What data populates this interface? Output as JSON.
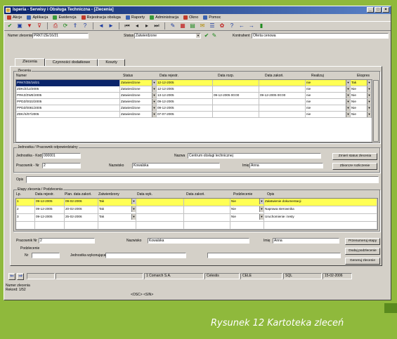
{
  "window": {
    "title": "Isperia - Serwisy i Obsługa Techniczna - [Zlecenia]"
  },
  "menu": [
    "Akcje",
    "Aplikacja",
    "Ewidencja",
    "Rejestracja obsługa",
    "Raporty",
    "Administracja",
    "Okno",
    "Pomoc"
  ],
  "toolbar_icons": [
    "check-icon",
    "save-icon",
    "filter-icon",
    "filter-clear-icon",
    "print-icon",
    "refresh-icon",
    "up-icon",
    "help-icon",
    "back-icon",
    "forward-icon",
    "first-icon",
    "prev-icon",
    "next-icon",
    "last-icon",
    "tools-icon",
    "calendar-icon",
    "calc-icon",
    "notes-icon",
    "mail-icon",
    "settings-icon",
    "question-icon",
    "arrow-left-icon",
    "arrow-right-icon",
    "exit-icon"
  ],
  "filters": {
    "order_no_label": "Numer zlecenia",
    "order_no_value": "PRKT/ZE/16/21",
    "status_label": "Status",
    "status_value": "Zatwierdzone",
    "client_label": "Kontrahent",
    "client_value": "Oferta cenowa"
  },
  "tabs": [
    "Zlecenia",
    "Czynności dodatkowe",
    "Koszty"
  ],
  "orders": {
    "group_label": "Zlecenia",
    "headers": [
      "Numer",
      "Status",
      "Data rejestr.",
      "Data rozp.",
      "Data zakoń.",
      "Realizuj",
      "Ekspres"
    ],
    "rows": [
      [
        "PRKT/ZE/16/21",
        "Zatwierdzone",
        "12-12-2005",
        "",
        "",
        "nie",
        "Tak"
      ],
      [
        "ZDK/Z/12/2005",
        "Zatwierdzone",
        "12-12-2005",
        "",
        "",
        "nie",
        "Nie"
      ],
      [
        "PRKZ/ZWE/2005",
        "Zatwierdzone",
        "13-12-2005",
        "09-12-2005 00:00",
        "09-12-2005 00:00",
        "nie",
        "Nie"
      ],
      [
        "PPDZ/0022/2005",
        "Zatwierdzone",
        "09-12-2005",
        "",
        "",
        "nie",
        "Nie"
      ],
      [
        "PPDZ/0081/2005",
        "Zatwierdzone",
        "09-12-2005",
        "",
        "",
        "nie",
        "Nie"
      ],
      [
        "ZDK/S/07/2005",
        "Zatwierdzone",
        "07-07-2005",
        "",
        "",
        "nie",
        "Nie"
      ]
    ]
  },
  "unit": {
    "group_label": "Jednostka / Pracownik odpowiedzialny",
    "unit_code_label": "Jednostka - Kod",
    "unit_code_value": "000001",
    "unit_name_label": "Nazwa",
    "unit_name_value": "Centrum obsługi technicznej",
    "employee_label": "Pracownik - Nr",
    "employee_no": "2",
    "surname_label": "Nazwisko",
    "surname_value": "Kowalska",
    "firstname_label": "Imię",
    "firstname_value": "Anna",
    "btn_change_status": "Zmień status zlecenia",
    "btn_history": "Zbiorcze rozliczenie"
  },
  "description": {
    "label": "Opis",
    "value": ""
  },
  "stages": {
    "group_label": "Etapy zlecenia / Podzlecenia",
    "headers": [
      "Lp.",
      "Data rejestr.",
      "Plan. data zakoń.",
      "Zatwierdzony",
      "Data wyk.",
      "Data zakoń.",
      "Podzlecenie",
      "Opis"
    ],
    "rows": [
      [
        "1",
        "09-12-2005",
        "09-02-2006",
        "Tak",
        "",
        "",
        "Nie",
        "Załatwienie dokumentacji"
      ],
      [
        "2",
        "09-12-2005",
        "20-02-2006",
        "Tak",
        "",
        "",
        "Nie",
        "Naprawa sterownika"
      ],
      [
        "3",
        "09-12-2005",
        "25-02-2006",
        "Tak",
        "",
        "",
        "Nie",
        "Uruchomienie i testy"
      ],
      [
        "",
        "",
        "",
        "",
        "",
        "",
        "",
        ""
      ]
    ]
  },
  "bottom": {
    "employee_label": "Pracownik Nr",
    "employee_value": "2",
    "surname_label": "Nazwisko",
    "surname_value": "Kowalska",
    "firstname_label": "Imię",
    "firstname_value": "Anna",
    "sub_label": "Podzlecenie",
    "nr_label": "Nr",
    "unit_label": "Jednostka wykonująca",
    "btn1": "Przenumeruj etapy",
    "btn2": "Dodaj podzlecenie",
    "btn3": "Generuj zlecenie"
  },
  "statusbar": {
    "company": "1 Comarch S.A.",
    "user": "Celestis",
    "code": "CELE",
    "mode": "SQL",
    "date": "15-02-2006"
  },
  "footer": {
    "line1": "Numer zlecenia",
    "line2": "Rekord: 1/52",
    "line3": "<OSC> <SIN>"
  },
  "caption": "Rysunek 12 Kartoteka zleceń",
  "colors": {
    "highlight": "#ffff55",
    "selected": "#0a246a",
    "background": "#8fb93c"
  }
}
